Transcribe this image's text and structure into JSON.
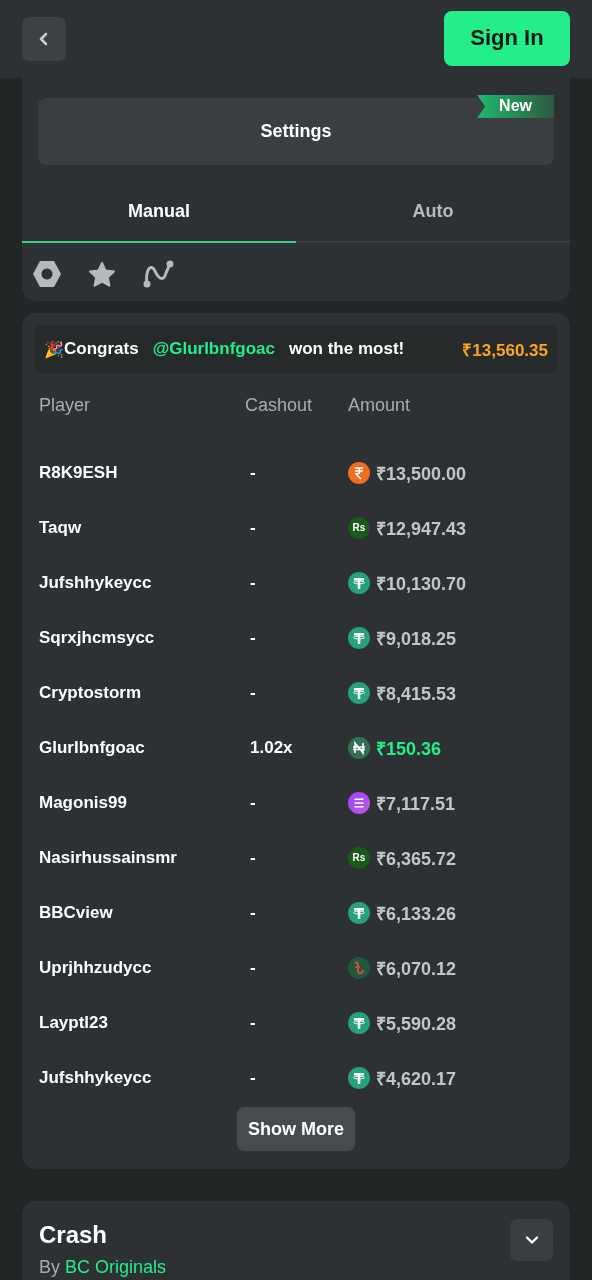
{
  "header": {
    "sign_in": "Sign In"
  },
  "settings": {
    "label": "Settings",
    "badge": "New"
  },
  "tabs": [
    {
      "label": "Manual",
      "selected": true
    },
    {
      "label": "Auto",
      "selected": false
    }
  ],
  "congrats": {
    "emoji": "🎉",
    "lead": "Congrats",
    "user": "@Glurlbnfgoac",
    "tail": "won the most!",
    "amount": "₹13,560.35"
  },
  "table": {
    "columns": [
      "Player",
      "Cashout",
      "Amount"
    ],
    "rows": [
      {
        "player": "R8K9ESH",
        "cashout": "-",
        "coin": {
          "kind": "inr"
        },
        "amount": "₹13,500.00",
        "won": false
      },
      {
        "player": "Taqw",
        "cashout": "-",
        "coin": {
          "kind": "rs",
          "label": "Rs"
        },
        "amount": "₹12,947.43",
        "won": false
      },
      {
        "player": "Jufshhykeycc",
        "cashout": "-",
        "coin": {
          "kind": "tether"
        },
        "amount": "₹10,130.70",
        "won": false
      },
      {
        "player": "Sqrxjhcmsycc",
        "cashout": "-",
        "coin": {
          "kind": "tether"
        },
        "amount": "₹9,018.25",
        "won": false
      },
      {
        "player": "Cryptostorm",
        "cashout": "-",
        "coin": {
          "kind": "tether"
        },
        "amount": "₹8,415.53",
        "won": false
      },
      {
        "player": "Glurlbnfgoac",
        "cashout": "1.02x",
        "coin": {
          "kind": "naira"
        },
        "amount": "₹150.36",
        "won": true
      },
      {
        "player": "Magonis99",
        "cashout": "-",
        "coin": {
          "kind": "sol"
        },
        "amount": "₹7,117.51",
        "won": false
      },
      {
        "player": "Nasirhussainsmr",
        "cashout": "-",
        "coin": {
          "kind": "rs",
          "label": "Rs"
        },
        "amount": "₹6,365.72",
        "won": false
      },
      {
        "player": "BBCview",
        "cashout": "-",
        "coin": {
          "kind": "tether"
        },
        "amount": "₹6,133.26",
        "won": false
      },
      {
        "player": "Uprjhhzudycc",
        "cashout": "-",
        "coin": {
          "kind": "taka"
        },
        "amount": "₹6,070.12",
        "won": false
      },
      {
        "player": "Layptl23",
        "cashout": "-",
        "coin": {
          "kind": "tether"
        },
        "amount": "₹5,590.28",
        "won": false
      },
      {
        "player": "Jufshhykeycc",
        "cashout": "-",
        "coin": {
          "kind": "tether"
        },
        "amount": "₹4,620.17",
        "won": false
      }
    ]
  },
  "show_more": "Show More",
  "game": {
    "title": "Crash",
    "by": "By",
    "provider": "BC Originals"
  }
}
